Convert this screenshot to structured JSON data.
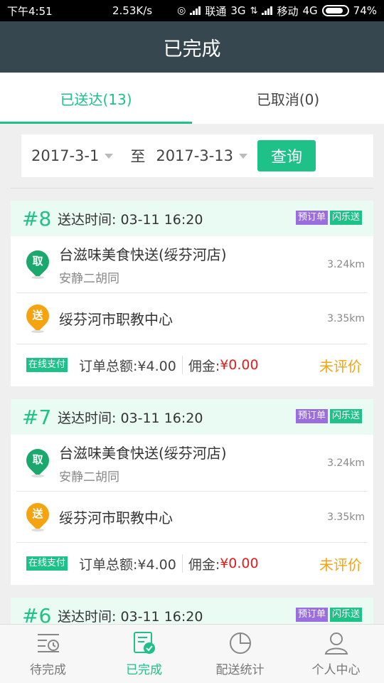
{
  "status_bar": {
    "time": "下午4:51",
    "speed": "2.53K/s",
    "carrier1": "联通",
    "net1": "3G",
    "carrier2": "移动",
    "net2": "4G",
    "battery": "74%"
  },
  "header": {
    "title": "已完成"
  },
  "tabs": [
    {
      "label": "已送达(13)",
      "active": true
    },
    {
      "label": "已取消(0)",
      "active": false
    }
  ],
  "filter": {
    "start_date": "2017-3-1",
    "to_label": "至",
    "end_date": "2017-3-13",
    "query_label": "查询"
  },
  "orders": [
    {
      "no": "#8",
      "time": "送达时间: 03-11 16:20",
      "badges": [
        "预订单",
        "闪乐送"
      ],
      "pickup_tag": "取",
      "shop": "台滋味美食快送(绥芬河店)",
      "shop_address": "安静二胡同",
      "pickup_distance": "3.24km",
      "deliver_tag": "送",
      "destination": "绥芬河市职教中心",
      "deliver_distance": "3.35km",
      "pay_tag": "在线支付",
      "total": "订单总额:¥4.00",
      "commission_label": "佣金:",
      "commission_value": "¥0.00",
      "review": "未评价"
    },
    {
      "no": "#7",
      "time": "送达时间: 03-11 16:20",
      "badges": [
        "预订单",
        "闪乐送"
      ],
      "pickup_tag": "取",
      "shop": "台滋味美食快送(绥芬河店)",
      "shop_address": "安静二胡同",
      "pickup_distance": "3.24km",
      "deliver_tag": "送",
      "destination": "绥芬河市职教中心",
      "deliver_distance": "3.35km",
      "pay_tag": "在线支付",
      "total": "订单总额:¥4.00",
      "commission_label": "佣金:",
      "commission_value": "¥0.00",
      "review": "未评价"
    },
    {
      "no": "#6",
      "time": "送达时间: 03-11 16:20",
      "badges": [
        "预订单",
        "闪乐送"
      ]
    }
  ],
  "bottom_nav": [
    {
      "label": "待完成",
      "icon": "pending-list-icon"
    },
    {
      "label": "已完成",
      "icon": "completed-check-icon"
    },
    {
      "label": "配送统计",
      "icon": "pie-chart-icon"
    },
    {
      "label": "个人中心",
      "icon": "person-icon"
    }
  ],
  "colors": {
    "accent": "#1ec289",
    "header_bg": "#37474f",
    "purple_badge": "#9b6ee0",
    "orange": "#f5a30f",
    "red": "#e21c1c"
  }
}
